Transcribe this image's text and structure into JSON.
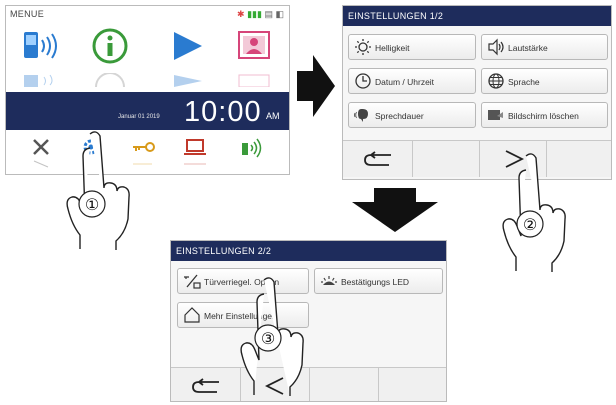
{
  "screen1": {
    "title": "MENUE",
    "date": "Januar 01 2019",
    "time": "10:00",
    "ampm": "AM"
  },
  "screen2": {
    "header": "EINSTELLUNGEN 1/2",
    "buttons": [
      {
        "label": "Helligkeit",
        "icon": "brightness-icon"
      },
      {
        "label": "Lautstärke",
        "icon": "volume-icon"
      },
      {
        "label": "Datum / Uhrzeit",
        "icon": "clock-icon"
      },
      {
        "label": "Sprache",
        "icon": "globe-icon"
      },
      {
        "label": "Sprechdauer",
        "icon": "talk-icon"
      },
      {
        "label": "Bildschirm löschen",
        "icon": "screen-clean-icon"
      }
    ],
    "nav_back": "↩",
    "nav_next": ">"
  },
  "screen3": {
    "header": "EINSTELLUNGEN 2/2",
    "buttons": [
      {
        "label": "Türverriegel. Option",
        "icon": "door-lock-icon"
      },
      {
        "label": "Bestätigungs LED",
        "icon": "led-icon"
      },
      {
        "label": "Mehr Einstellungen",
        "icon": "house-icon"
      }
    ],
    "nav_back": "↩",
    "nav_prev": "<"
  },
  "steps": [
    "①",
    "②",
    "③"
  ],
  "colors": {
    "header": "#1e2c5c",
    "accent_blue": "#2a7bd0",
    "accent_green": "#3a9a3a",
    "accent_pink": "#d6457a"
  }
}
